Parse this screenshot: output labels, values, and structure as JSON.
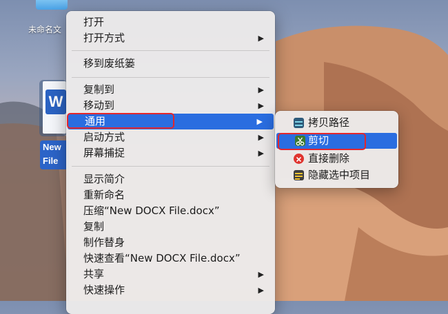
{
  "desktop": {
    "top_item_label": "未命名文",
    "file_label_line1": "New",
    "file_label_line2": "File",
    "file_app_letter": "W"
  },
  "menu": {
    "items": [
      {
        "label": "打开",
        "submenu": false
      },
      {
        "label": "打开方式",
        "submenu": true
      },
      {
        "label": "移到废纸篓",
        "submenu": false
      },
      {
        "label": "复制到",
        "submenu": true
      },
      {
        "label": "移动到",
        "submenu": true
      },
      {
        "label": "通用",
        "submenu": true,
        "highlighted": true
      },
      {
        "label": "启动方式",
        "submenu": true
      },
      {
        "label": "屏幕捕捉",
        "submenu": true
      },
      {
        "label": "显示简介",
        "submenu": false
      },
      {
        "label": "重新命名",
        "submenu": false
      },
      {
        "label": "压缩“New DOCX File.docx”",
        "submenu": false
      },
      {
        "label": "复制",
        "submenu": false
      },
      {
        "label": "制作替身",
        "submenu": false
      },
      {
        "label": "快速查看“New DOCX File.docx”",
        "submenu": false
      },
      {
        "label": "共享",
        "submenu": true
      },
      {
        "label": "快速操作",
        "submenu": true
      }
    ],
    "arrow_glyph": "▶"
  },
  "submenu": {
    "items": [
      {
        "label": "拷贝路径",
        "icon": "copy-path-icon",
        "color": "#2e5b7a"
      },
      {
        "label": "剪切",
        "icon": "scissors-icon",
        "color": "#3a7a2e",
        "highlighted": true
      },
      {
        "label": "直接删除",
        "icon": "delete-icon",
        "color": "#e0342f"
      },
      {
        "label": "隐藏选中项目",
        "icon": "hide-items-icon",
        "color": "#3f3f3f"
      }
    ]
  },
  "colors": {
    "highlight": "#2a6de0",
    "annotation_red": "#e2262c"
  }
}
